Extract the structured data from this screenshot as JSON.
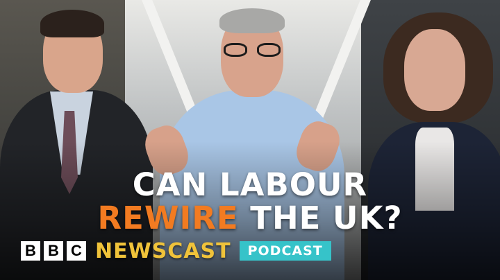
{
  "headline": {
    "line1": "CAN LABOUR",
    "line2_highlight": "REWIRE",
    "line2_rest": " THE UK?"
  },
  "branding": {
    "bbc_letters": [
      "B",
      "B",
      "C"
    ],
    "show_name": "NEWSCAST",
    "badge": "PODCAST"
  },
  "colors": {
    "highlight": "#f27b21",
    "show_name": "#f0c33a",
    "badge_bg": "#36c3c9"
  }
}
